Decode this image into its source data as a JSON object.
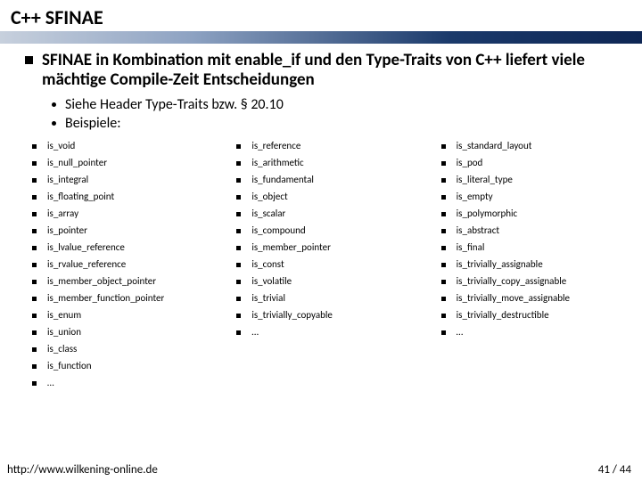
{
  "title": "C++ SFINAE",
  "lead": "SFINAE in Kombination mit enable_if und den Type-Traits von C++ liefert viele mächtige Compile-Zeit Entscheidungen",
  "sub_bullets": [
    "Siehe Header Type-Traits bzw. § 20.10",
    "Beispiele:"
  ],
  "columns": [
    [
      "is_void",
      "is_null_pointer",
      "is_integral",
      "is_floating_point",
      "is_array",
      "is_pointer",
      "is_lvalue_reference",
      "is_rvalue_reference",
      "is_member_object_pointer",
      "is_member_function_pointer",
      "is_enum",
      "is_union",
      "is_class",
      "is_function",
      "…"
    ],
    [
      "is_reference",
      "is_arithmetic",
      "is_fundamental",
      "is_object",
      "is_scalar",
      "is_compound",
      "is_member_pointer",
      "is_const",
      "is_volatile",
      "is_trivial",
      "is_trivially_copyable",
      "…"
    ],
    [
      "is_standard_layout",
      "is_pod",
      "is_literal_type",
      "is_empty",
      "is_polymorphic",
      "is_abstract",
      "is_final",
      "is_trivially_assignable",
      "is_trivially_copy_assignable",
      "is_trivially_move_assignable",
      "is_trivially_destructible",
      "…"
    ]
  ],
  "footer": {
    "url": "http://www.wilkening-online.de",
    "page": "41 / 44"
  }
}
